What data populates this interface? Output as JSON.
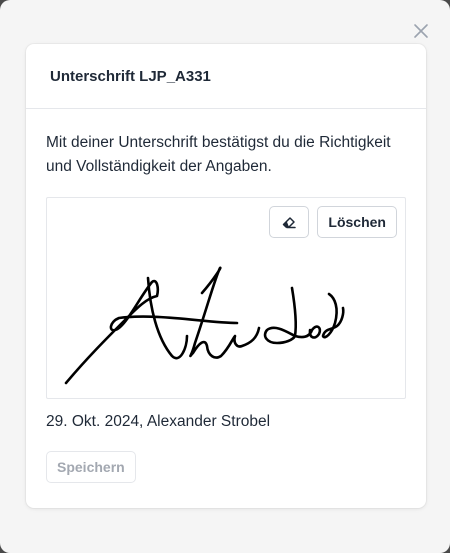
{
  "dialog": {
    "title": "Unterschrift LJP_A331",
    "description": "Mit deiner Unterschrift bestätigst du die Richtigkeit und Vollständigkeit der Angaben.",
    "close_icon": "close-icon"
  },
  "signature_pad": {
    "eraser_icon": "eraser-icon",
    "clear_label": "Löschen",
    "signature_image": "handwritten-signature"
  },
  "caption": "29. Okt. 2024, Alexander Strobel",
  "save_label": "Speichern",
  "colors": {
    "backdrop": "#4a4a4a",
    "modal_bg": "#f5f5f5",
    "text": "#1f2937",
    "disabled_text": "#a3a8b1",
    "border": "#e5e7eb"
  }
}
